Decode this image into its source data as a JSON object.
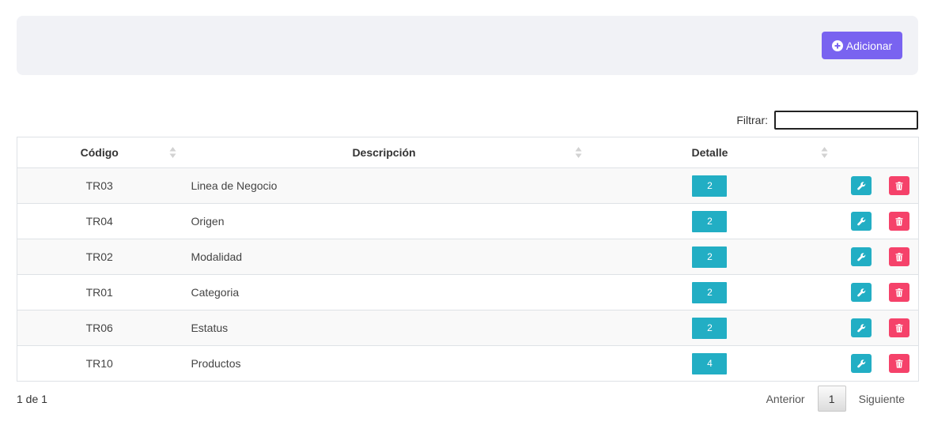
{
  "toolbar": {
    "add_label": "Adicionar"
  },
  "filter": {
    "label": "Filtrar:",
    "value": ""
  },
  "table": {
    "columns": [
      "Código",
      "Descripción",
      "Detalle"
    ],
    "rows": [
      {
        "code": "TR03",
        "description": "Linea de Negocio",
        "detail": "2"
      },
      {
        "code": "TR04",
        "description": "Origen",
        "detail": "2"
      },
      {
        "code": "TR02",
        "description": "Modalidad",
        "detail": "2"
      },
      {
        "code": "TR01",
        "description": "Categoria",
        "detail": "2"
      },
      {
        "code": "TR06",
        "description": "Estatus",
        "detail": "2"
      },
      {
        "code": "TR10",
        "description": "Productos",
        "detail": "4"
      }
    ]
  },
  "pagination": {
    "info": "1 de 1",
    "previous": "Anterior",
    "current": "1",
    "next": "Siguiente"
  },
  "colors": {
    "primary": "#7963f0",
    "info": "#22aec4",
    "danger": "#f5426a",
    "toolbar_bg": "#f1f2f6"
  },
  "icons": {
    "add": "plus-circle-icon",
    "edit": "wrench-icon",
    "delete": "trash-icon",
    "sort": "sort-icon"
  }
}
